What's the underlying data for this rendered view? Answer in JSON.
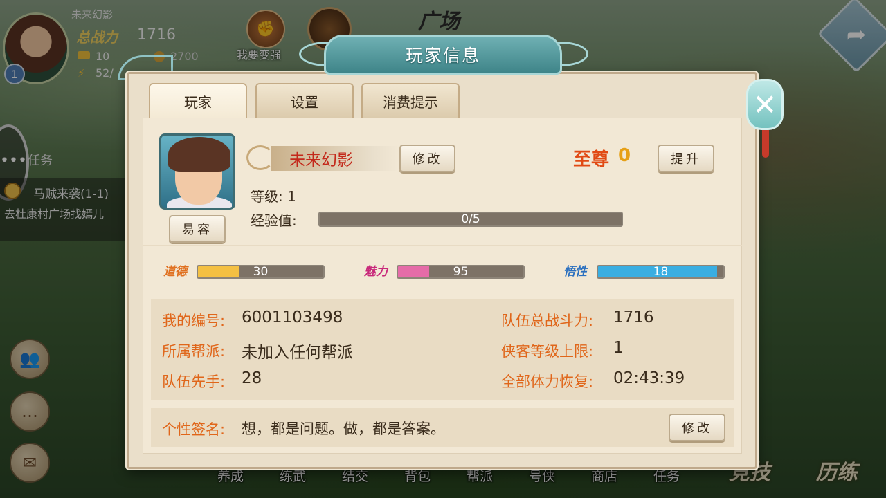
{
  "hud": {
    "player_name": "未来幻影",
    "power_label": "总战力",
    "power_value": "1716",
    "level": "1",
    "gold": "10",
    "stamina": "52/",
    "coins": "2700",
    "strong_label": "我要变强",
    "location": "广场"
  },
  "quest": {
    "section_title": "任务",
    "name": "马贼来袭(1-1)",
    "desc": "去杜康村广场找嫣儿"
  },
  "bottom_nav": [
    "养成",
    "练武",
    "结交",
    "背包",
    "帮派",
    "号侠",
    "商店",
    "任务"
  ],
  "big_buttons": [
    "竞技",
    "历练"
  ],
  "dialog": {
    "title": "玩家信息",
    "tabs": [
      "玩家",
      "设置",
      "消费提示"
    ],
    "active_tab": 0,
    "player": {
      "name": "未来幻影",
      "modify_label": "修改",
      "vip_label": "至尊",
      "vip_value": "0",
      "upgrade_label": "提升",
      "change_face_label": "易容",
      "level_text": "等级: 1",
      "exp_label": "经验值:",
      "exp_text": "0/5",
      "exp_fraction": 0.0
    },
    "attributes": [
      {
        "icon": "morality-icon",
        "glyph": "道德",
        "value": "30",
        "fill": 0.33,
        "color": "#f4c043",
        "icon_color": "#e07020"
      },
      {
        "icon": "charm-icon",
        "glyph": "魅力",
        "value": "95",
        "fill": 0.25,
        "color": "#e56ca8",
        "icon_color": "#c8287a"
      },
      {
        "icon": "comprehension-icon",
        "glyph": "悟性",
        "value": "18",
        "fill": 0.95,
        "color": "#3aaee2",
        "icon_color": "#2a6fbf"
      }
    ],
    "info": {
      "id_label": "我的编号:",
      "id_value": "6001103498",
      "guild_label": "所属帮派:",
      "guild_value": "未加入任何帮派",
      "initiative_label": "队伍先手:",
      "initiative_value": "28",
      "team_power_label": "队伍总战斗力:",
      "team_power_value": "1716",
      "hero_cap_label": "侠客等级上限:",
      "hero_cap_value": "1",
      "stamina_recover_label": "全部体力恢复:",
      "stamina_recover_value": "02:43:39"
    },
    "signature": {
      "label": "个性签名:",
      "text": "想，都是问题。做，都是答案。",
      "modify_label": "修改"
    }
  }
}
